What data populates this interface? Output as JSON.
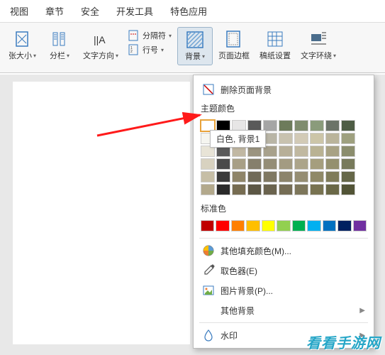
{
  "menubar": {
    "items": [
      "视图",
      "章节",
      "安全",
      "开发工具",
      "特色应用"
    ]
  },
  "toolbar": {
    "size_label": "张大小",
    "columns_label": "分栏",
    "textdir_label": "文字方向",
    "separator_label": "分隔符",
    "linenum_label": "行号",
    "background_label": "背景",
    "pageborder_label": "页面边框",
    "manuscript_label": "稿纸设置",
    "textwrap_label": "文字环绕"
  },
  "dropdown": {
    "remove_bg": "删除页面背景",
    "theme_colors_label": "主题颜色",
    "standard_colors_label": "标准色",
    "tooltip": "白色, 背景1",
    "more_fill": "其他填充颜色(M)...",
    "eyedropper": "取色器(E)",
    "picture_bg": "图片背景(P)...",
    "other_bg": "其他背景",
    "watermark": "水印",
    "theme_rows": [
      [
        "#ffffff",
        "#000000",
        "#e7e6e6",
        "#595959",
        "#a5a5a5",
        "#6d7b5b",
        "#7f8c6e",
        "#8a9b7b",
        "#6b7368",
        "#4e5d45"
      ],
      [
        "#f5f5f0",
        "#7f7f7f",
        "#d6cfc2",
        "#aca899",
        "#b9b5a6",
        "#c8c2af",
        "#d2cab6",
        "#ccc5a8",
        "#bab49b",
        "#9ea07f"
      ],
      [
        "#e8e4d7",
        "#5b5b5b",
        "#c1b8a3",
        "#9b9480",
        "#a8a18c",
        "#b7af98",
        "#c0b8a0",
        "#b9b293",
        "#a8a284",
        "#8b8d6d"
      ],
      [
        "#d8d2c0",
        "#4a4a4a",
        "#a89f86",
        "#867f6c",
        "#948d77",
        "#a39b82",
        "#aca48a",
        "#a59e7e",
        "#94906f",
        "#787a5b"
      ],
      [
        "#c6bea6",
        "#3a3a3a",
        "#8f8569",
        "#716b58",
        "#7f7862",
        "#8c846b",
        "#958d72",
        "#8f8967",
        "#7f7c5a",
        "#656748"
      ],
      [
        "#b3a98c",
        "#2a2a2a",
        "#766c51",
        "#5c5745",
        "#6a634e",
        "#756d55",
        "#7d765b",
        "#787351",
        "#6a6847",
        "#525436"
      ]
    ],
    "standard_row": [
      "#c00000",
      "#ff0000",
      "#ff7f00",
      "#ffbf00",
      "#ffff00",
      "#92d050",
      "#00b050",
      "#00b0f0",
      "#0070c0",
      "#002060",
      "#7030a0"
    ]
  },
  "watermark_text": "看看手游网"
}
